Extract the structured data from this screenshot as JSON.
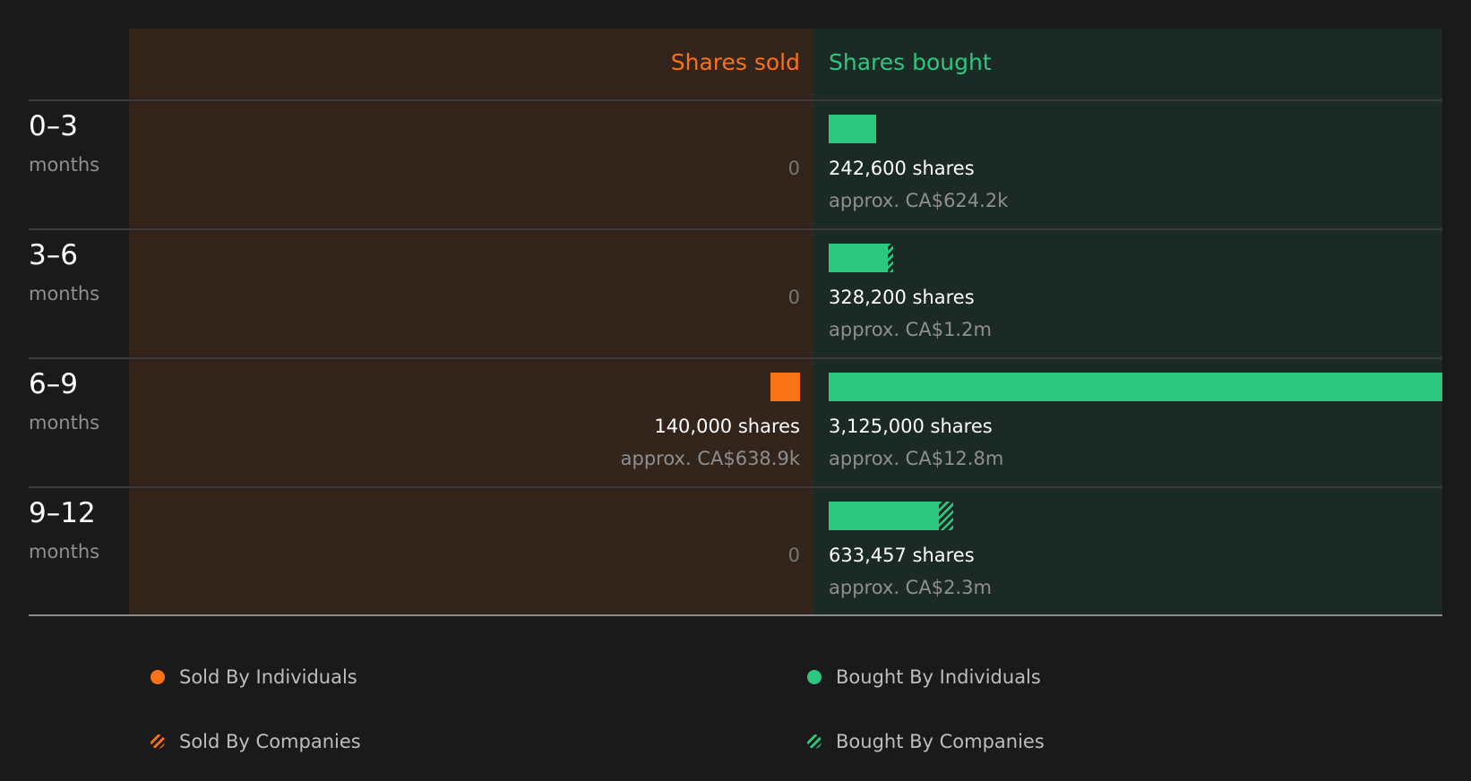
{
  "colors": {
    "sold": "#f97316",
    "bought": "#2dc77f",
    "sold_panel": "#33241c",
    "bought_panel": "#1b2a24"
  },
  "headers": {
    "sold": "Shares sold",
    "bought": "Shares bought"
  },
  "legend": {
    "sold_individuals": "Sold By Individuals",
    "sold_companies": "Sold By Companies",
    "bought_individuals": "Bought By Individuals",
    "bought_companies": "Bought By Companies"
  },
  "chart_data": {
    "type": "bar",
    "categories": [
      "0–3",
      "3–6",
      "6–9",
      "9–12"
    ],
    "category_unit": "months",
    "series": [
      {
        "name": "Sold By Individuals",
        "values": [
          0,
          0,
          140000,
          0
        ]
      },
      {
        "name": "Sold By Companies",
        "values": [
          0,
          0,
          0,
          0
        ]
      },
      {
        "name": "Bought By Individuals",
        "values": [
          242600,
          300000,
          3125000,
          560000
        ]
      },
      {
        "name": "Bought By Companies",
        "values": [
          0,
          28200,
          0,
          73457
        ]
      }
    ],
    "sold_totals": [
      0,
      0,
      140000,
      0
    ],
    "bought_totals": [
      242600,
      328200,
      3125000,
      633457
    ],
    "sold_labels": [
      "0",
      "0",
      "140,000 shares",
      "0"
    ],
    "sold_values": [
      "",
      "",
      "approx. CA$638.9k",
      ""
    ],
    "bought_labels": [
      "242,600 shares",
      "328,200 shares",
      "3,125,000 shares",
      "633,457 shares"
    ],
    "bought_values": [
      "approx. CA$624.2k",
      "approx. CA$1.2m",
      "approx. CA$12.8m",
      "approx. CA$2.3m"
    ],
    "xlim": [
      0,
      3125000
    ]
  }
}
